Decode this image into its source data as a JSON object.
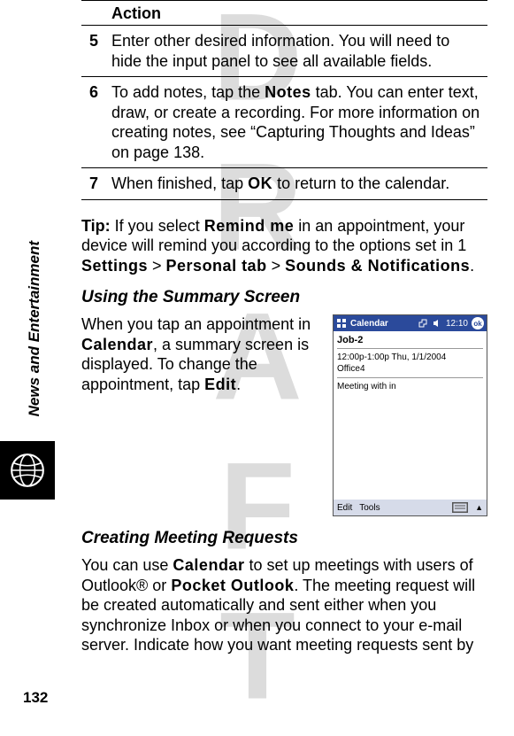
{
  "watermark": "DRAFT",
  "page_number": "132",
  "sidebar_label": "News and Entertainment",
  "table": {
    "header": "Action",
    "rows": [
      {
        "num": "5",
        "text": "Enter other desired information. You will need to hide the input panel to see all available fields."
      },
      {
        "num": "6",
        "text_pre": "To add notes, tap the ",
        "bold1": "Notes",
        "text_post": " tab. You can enter text, draw, or create a recording. For more information on creating notes, see “Capturing Thoughts and Ideas” on page 138."
      },
      {
        "num": "7",
        "text_pre": "When finished, tap ",
        "bold1": "OK",
        "text_post": " to return to the calendar."
      }
    ]
  },
  "tip": {
    "label": "Tip:",
    "pre": " If you select ",
    "b1": "Remind me",
    "mid1": " in an appointment, your device will remind you according to the options set in ",
    "icon": "1",
    "b2": "Settings",
    "sep1": " > ",
    "b3": "Personal tab",
    "sep2": " > ",
    "b4": "Sounds & Notifications",
    "end": "."
  },
  "section1": "Using the Summary Screen",
  "summary": {
    "pre": "When you tap an appointment in ",
    "b1": "Calendar",
    "mid": ", a summary screen is displayed. To change the appointment, tap ",
    "b2": "Edit",
    "end": "."
  },
  "device": {
    "title": "Calendar",
    "time": "12:10",
    "ok": "ok",
    "appt_title": "Job-2",
    "appt_time": "12:00p-1:00p Thu, 1/1/2004",
    "appt_loc": "Office4",
    "appt_note": "Meeting with in",
    "tool_edit": "Edit",
    "tool_tools": "Tools"
  },
  "section2": "Creating Meeting Requests",
  "meeting": {
    "pre": "You can use ",
    "b1": "Calendar",
    "mid1": " to set up meetings with users of Outlook® or ",
    "b2": "Pocket Outlook",
    "mid2": ". The meeting request will be created automatically and sent either when you synchronize Inbox or when you connect to your e-mail server. Indicate how you want meeting requests sent by"
  }
}
